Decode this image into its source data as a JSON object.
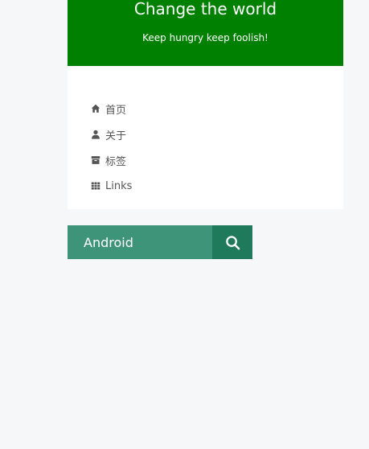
{
  "header": {
    "title": "Change the world",
    "subtitle": "Keep hungry keep foolish!"
  },
  "menu": {
    "items": [
      {
        "icon": "home-icon",
        "label": "首页"
      },
      {
        "icon": "user-icon",
        "label": "关于"
      },
      {
        "icon": "archive-icon",
        "label": "标签"
      },
      {
        "icon": "grid-icon",
        "label": "Links"
      }
    ]
  },
  "search": {
    "value": "Android",
    "placeholder": "",
    "button_icon": "search-icon"
  },
  "colors": {
    "header_bg": "#008000",
    "search_input_bg": "#3e9479",
    "search_button_bg": "#1e7a5a",
    "page_bg": "#f5f7f9"
  }
}
